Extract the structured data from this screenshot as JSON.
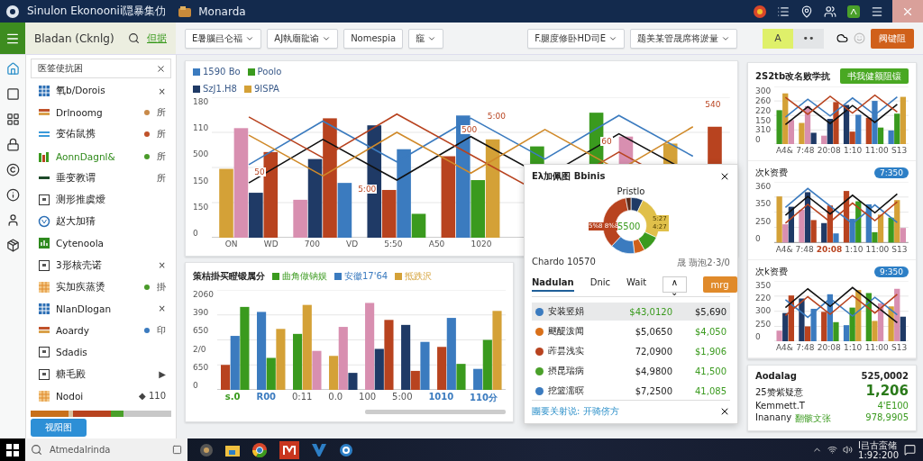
{
  "title_bar": {
    "app_title": "Sinulon Ekonoonii隠暴集仂",
    "tab_title": "Monarda"
  },
  "sidebar_header": {
    "title": "Bladan (Cknlg)",
    "action": "但据"
  },
  "toolbar": {
    "dropdowns": [
      {
        "label": "E暑腦㠯仑福",
        "kind": "dropdown"
      },
      {
        "label": "AJ執廟龍谕",
        "kind": "dropdown"
      },
      {
        "label": "Nomespia",
        "kind": "button"
      },
      {
        "label": "竉",
        "kind": "dropdown"
      }
    ],
    "right_dropdowns": [
      {
        "label": "F.腿度修卧HD司E",
        "kind": "dropdown"
      },
      {
        "label": "题美某管晟席将淤量",
        "kind": "dropdown"
      }
    ],
    "toggles": [
      {
        "label": "A",
        "selected": true
      },
      {
        "label": "••",
        "selected": false
      }
    ],
    "primary_button": "阀键阻"
  },
  "rail": [
    {
      "selected": true
    },
    {
      "selected": false
    },
    {
      "selected": false
    },
    {
      "selected": false
    },
    {
      "selected": false
    },
    {
      "selected": false
    },
    {
      "selected": false
    },
    {
      "selected": false
    }
  ],
  "sidebar": {
    "search": {
      "value": "医签使抗困"
    },
    "items": [
      {
        "label": "氧b/Dorois",
        "selected": false,
        "trailing": "×"
      },
      {
        "label": "Drlnoomg",
        "selected": false,
        "color": "#c88a4a",
        "trailing": "所"
      },
      {
        "label": "变佑鼠携",
        "selected": false,
        "color": "#c0522a",
        "trailing": "所"
      },
      {
        "label": "AonnDagnl&",
        "selected": true,
        "color": "#4a9a2a",
        "trailing": "所"
      },
      {
        "label": "垂变教谓",
        "selected": false,
        "trailing": "所"
      },
      {
        "label": "测形推虞燰",
        "selected": false
      },
      {
        "label": "赵大加猜",
        "selected": false
      },
      {
        "label": "Cytenoola",
        "selected": false
      },
      {
        "label": "3形核壳诺",
        "selected": false,
        "trailing": "×"
      },
      {
        "label": "实加疾蒸烫",
        "selected": false,
        "color": "#4a9a2a",
        "trailing": "掛"
      },
      {
        "label": "NlanDlogan",
        "selected": false,
        "trailing": "×"
      },
      {
        "label": "Aoardy",
        "selected": false,
        "color": "#3b7bbf",
        "trailing": "印"
      },
      {
        "label": "Sdadis",
        "selected": false
      },
      {
        "label": "糖毛殿",
        "selected": false,
        "trailing": "▶"
      },
      {
        "label": "Nodoi",
        "selected": false,
        "trailing": "◆ 110"
      }
    ],
    "usage_bar": [
      {
        "color": "#c8701a"
      },
      {
        "color": "#d9c3a0"
      },
      {
        "color": "#b8431f"
      },
      {
        "color": "#4aa02a"
      },
      {
        "color": "#c8c8c8"
      }
    ],
    "button": "视阳图"
  },
  "main_chart": {
    "legend": [
      {
        "label": "1590 Bo",
        "color": "#3b7bbf"
      },
      {
        "label": "Poolo",
        "color": "#3a9a1e"
      },
      {
        "label": "SzJ1.H8",
        "color": "#1f3a66"
      },
      {
        "label": "9ISPA",
        "color": "#d4a137"
      }
    ],
    "y_ticks": [
      "180",
      "110",
      "500",
      "150",
      "150",
      "0"
    ],
    "x_labels": [
      {
        "text": "ON"
      },
      {
        "text": "WD"
      },
      {
        "text": "700"
      },
      {
        "text": "VD"
      },
      {
        "text": "5:50"
      },
      {
        "text": "A50"
      },
      {
        "text": "1020"
      }
    ],
    "annotations": [
      "500",
      "5:00",
      "50",
      "60",
      "5:00",
      "540"
    ]
  },
  "bottom_chart": {
    "title": "策桔掛买瞪锻属分",
    "legend": [
      {
        "label": "曲角做钠娱",
        "color": "#3a9a1e"
      },
      {
        "label": "安徽17'64",
        "color": "#3b7bbf"
      },
      {
        "label": "抵跌沢",
        "color": "#d4a137"
      }
    ],
    "y_ticks": [
      "2060",
      "390",
      "650",
      "2/0",
      "650",
      "0"
    ],
    "x_labels": [
      {
        "text": "s.0",
        "color": "#3a9a1e"
      },
      {
        "text": "R00",
        "color": "#3b7bbf"
      },
      {
        "text": "0:11"
      },
      {
        "text": "0.0"
      },
      {
        "text": "100"
      },
      {
        "text": "5:00"
      },
      {
        "text": "1010",
        "color": "#3b7bbf"
      },
      {
        "text": "110分",
        "color": "#3b7bbf"
      }
    ]
  },
  "popup": {
    "title": "Eλ加佩图 Bbinis",
    "subtitle": "Pristlo",
    "donut_labels": [
      "5%8 8%8",
      "5500",
      "5:27 4:27"
    ],
    "note": "Chardo 10570",
    "legend_note": "晟 翡泡2·3/0",
    "tabs": [
      {
        "label": "Nadulan",
        "selected": true
      },
      {
        "label": "Dnic",
        "selected": false
      },
      {
        "label": "Wait",
        "selected": false
      }
    ],
    "sort": "∧ ⌄",
    "button": "mrg",
    "rows": [
      {
        "name": "安装竖娟",
        "value": "$43,0120",
        "change": "$5,690",
        "selected": true,
        "color": "#3b7bbf",
        "kind": "value"
      },
      {
        "name": "颰醍泼闻",
        "value": "$5,0650",
        "change": "$4,050",
        "selected": false,
        "color": "#d9701a",
        "kind": "change"
      },
      {
        "name": "葃昙浅实",
        "value": "72,0900",
        "change": "$1,906",
        "selected": false,
        "color": "#b8431f",
        "kind": "change"
      },
      {
        "name": "摂昆瑞病",
        "value": "$4,9800",
        "change": "41,500",
        "selected": false,
        "color": "#4aa02a",
        "kind": "change"
      },
      {
        "name": "挖篮濡暝",
        "value": "$7,2500",
        "change": "41,085",
        "selected": false,
        "color": "#3b7bbf",
        "kind": "change"
      }
    ],
    "footer": "團要关射说: 开骑侪方"
  },
  "side_charts": {
    "title": "2S2tb改名败学抗",
    "button": "书我健额阻镶",
    "charts": [
      {
        "y_ticks": [
          "300",
          "260",
          "220",
          "150",
          "310",
          "0"
        ],
        "x_labels": [
          {
            "text": "A4&"
          },
          {
            "text": "7:48"
          },
          {
            "text": "20:08"
          },
          {
            "text": "1:10"
          },
          {
            "text": "11:00"
          },
          {
            "text": "S13"
          }
        ]
      },
      {
        "title": "次k资费",
        "badge": "7:350",
        "y_ticks": [
          "360",
          "350",
          "250",
          "0"
        ],
        "x_labels": [
          {
            "text": "A4&"
          },
          {
            "text": "7:48"
          },
          {
            "text": "20:08",
            "color": "#b8431f"
          },
          {
            "text": "1:10"
          },
          {
            "text": "11:00"
          },
          {
            "text": "S13"
          }
        ]
      },
      {
        "title": "次k资费",
        "badge": "9:350",
        "y_ticks": [
          "350",
          "220",
          "300",
          "250",
          "0"
        ],
        "x_labels": [
          {
            "text": "A4&"
          },
          {
            "text": "7:48"
          },
          {
            "text": "20:08"
          },
          {
            "text": "1:10"
          },
          {
            "text": "11:00"
          },
          {
            "text": "S13"
          }
        ]
      }
    ]
  },
  "summary": {
    "title": "Aodalag",
    "total": "525,0002",
    "metric_label": "25赞紫疑意",
    "metric_value": "1,206",
    "rows": [
      {
        "label": "Kemmett.T",
        "value": "4'E100"
      },
      {
        "label": "Inanany",
        "tag": "翻骸文张",
        "value": "978,9905"
      }
    ]
  },
  "taskbar": {
    "search": "Atmedalrinda",
    "tray_text": "I㠯古蛮储",
    "time": "1:92:200"
  }
}
